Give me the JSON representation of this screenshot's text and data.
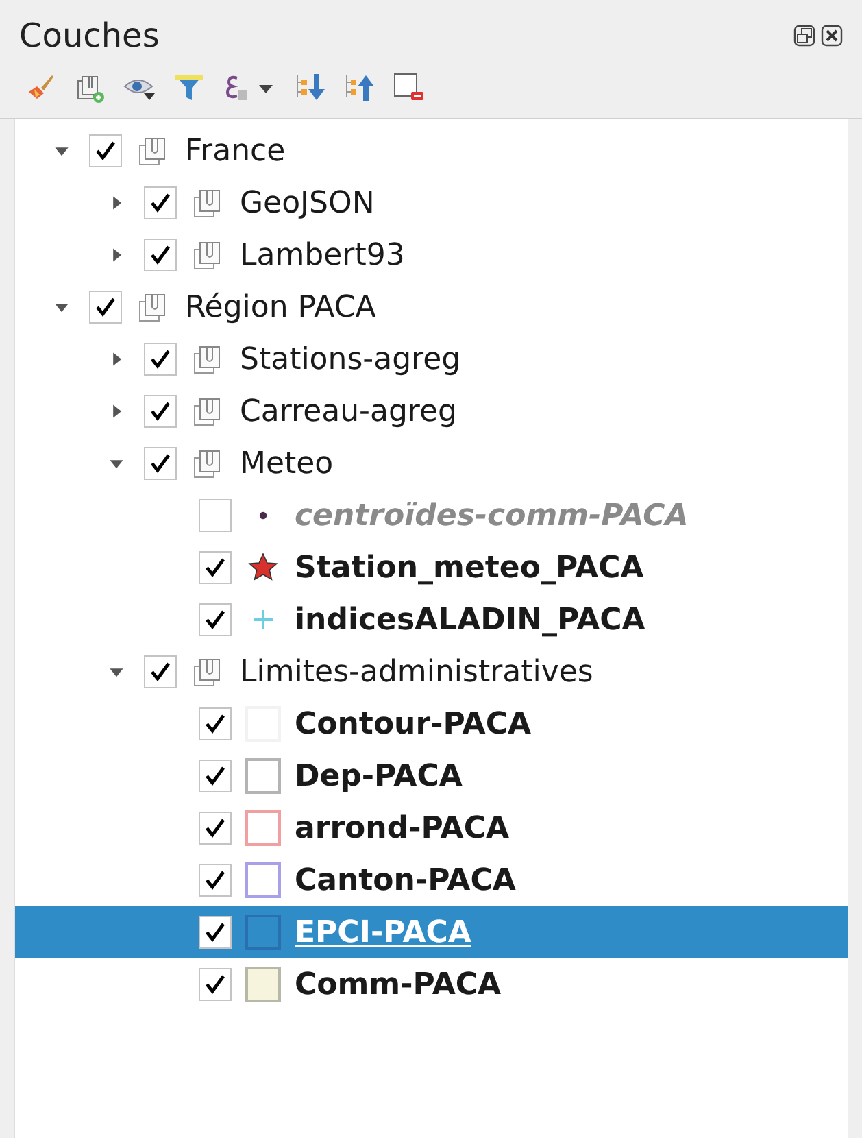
{
  "panel": {
    "title": "Couches"
  },
  "layers": [
    {
      "kind": "group",
      "label": "France",
      "checked": true,
      "expanded": true,
      "selected": false,
      "children": [
        {
          "kind": "group",
          "label": "GeoJSON",
          "checked": true,
          "expanded": false,
          "selected": false
        },
        {
          "kind": "group",
          "label": "Lambert93",
          "checked": true,
          "expanded": false,
          "selected": false
        }
      ]
    },
    {
      "kind": "group",
      "label": "Région PACA",
      "checked": true,
      "expanded": true,
      "selected": false,
      "children": [
        {
          "kind": "group",
          "label": "Stations-agreg",
          "checked": true,
          "expanded": false,
          "selected": false
        },
        {
          "kind": "group",
          "label": "Carreau-agreg",
          "checked": true,
          "expanded": false,
          "selected": false
        },
        {
          "kind": "group",
          "label": "Meteo",
          "checked": true,
          "expanded": true,
          "selected": false,
          "children": [
            {
              "kind": "point",
              "label": "centroïdes-comm-PACA",
              "checked": false,
              "selected": false,
              "color": "#4a2a4a"
            },
            {
              "kind": "star",
              "label": "Station_meteo_PACA",
              "checked": true,
              "selected": false,
              "color": "#d8302c"
            },
            {
              "kind": "cross",
              "label": "indicesALADIN_PACA",
              "checked": true,
              "selected": false,
              "color": "#6ad0e0"
            }
          ]
        },
        {
          "kind": "group",
          "label": "Limites-administratives",
          "checked": true,
          "expanded": true,
          "selected": false,
          "children": [
            {
              "kind": "polygon",
              "label": "Contour-PACA",
              "checked": true,
              "selected": false,
              "color": "#f2f2f2"
            },
            {
              "kind": "polygon",
              "label": "Dep-PACA",
              "checked": true,
              "selected": false,
              "color": "#b4b4b4"
            },
            {
              "kind": "polygon",
              "label": "arrond-PACA",
              "checked": true,
              "selected": false,
              "color": "#f0a0a0"
            },
            {
              "kind": "polygon",
              "label": "Canton-PACA",
              "checked": true,
              "selected": false,
              "color": "#a8a0e8"
            },
            {
              "kind": "polygon",
              "label": "EPCI-PACA",
              "checked": true,
              "selected": true,
              "color": "#2a70b0"
            },
            {
              "kind": "filled-polygon",
              "label": "Comm-PACA",
              "checked": true,
              "selected": false,
              "color": "#f6f4dc"
            }
          ]
        }
      ]
    }
  ]
}
